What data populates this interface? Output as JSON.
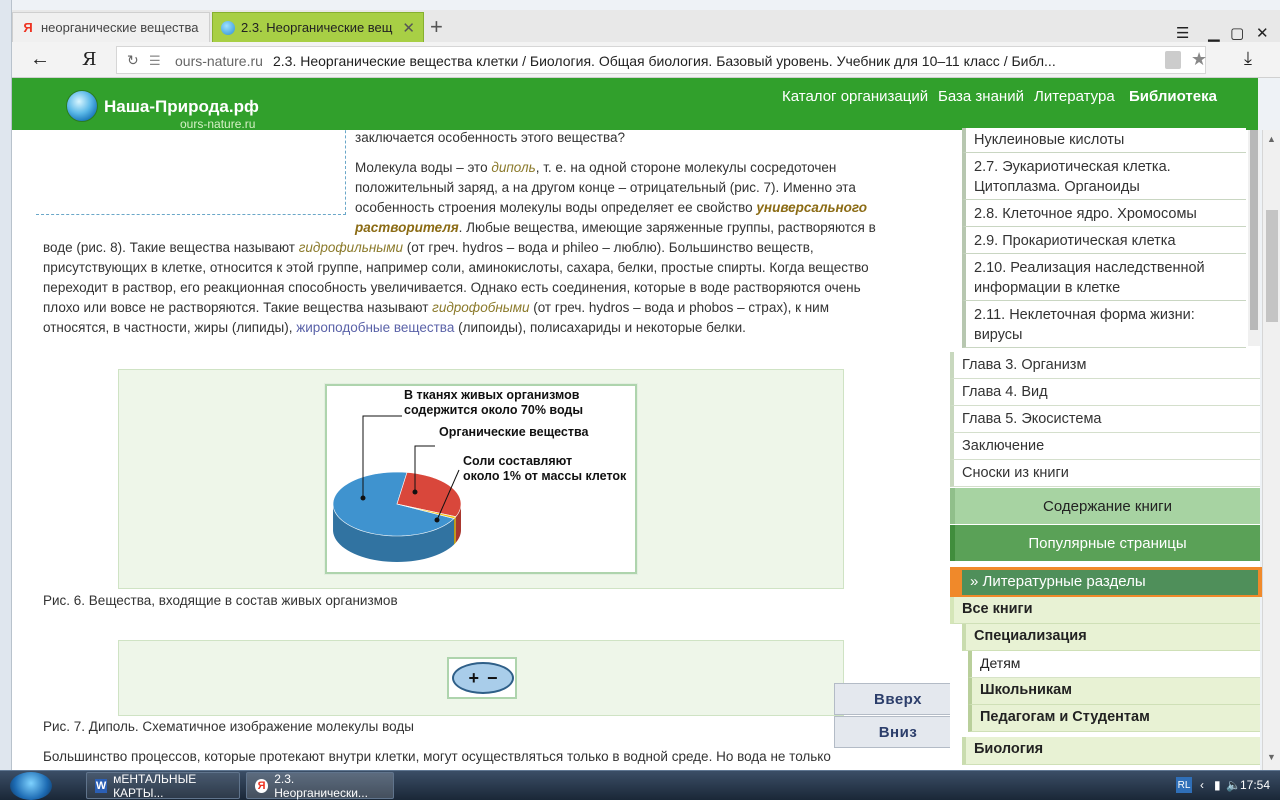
{
  "browser": {
    "tabs": [
      {
        "label": "неорганические вещества к",
        "active": false
      },
      {
        "label": "2.3. Неорганические вещ",
        "active": true
      }
    ],
    "new_tab": "+",
    "address": {
      "ya": "Я",
      "domain": "ours-nature.ru",
      "title": "2.3. Неорганические вещества клетки / Биология. Общая биология. Базовый уровень. Учебник для 10–11 класс / Библ..."
    }
  },
  "site": {
    "logo": "Наша-Природа.рф",
    "logo_sub": "ours-nature.ru",
    "nav": [
      "Каталог организаций",
      "База знаний",
      "Литература",
      "Библиотека"
    ]
  },
  "content": {
    "line_top": "заключается особенность этого вещества?",
    "p1_a": "Молекула воды – это ",
    "p1_term": "диполь",
    "p1_b": ", т. е. на одной стороне молекулы сосредоточен",
    "p1_line2": "положительный заряд, а на другом конце – отрицательный (рис. 7). Именно эта",
    "p1_line3_a": "особенность строения молекулы воды определяет ее свойство ",
    "p1_term2_a": "универсального",
    "p1_term2_b": "растворителя",
    "p1_line4_b": ". Любые вещества, имеющие заряженные группы, растворяются в",
    "p2_line1_a": "воде (рис. 8). Такие вещества называют ",
    "p2_term": "гидрофильными",
    "p2_line1_b": " (от греч. hydros – вода и phileo – люблю). Большинство веществ,",
    "p2_line2": "присутствующих в клетке, относится к этой группе, например соли, аминокислоты, сахара, белки, простые спирты. Когда вещество",
    "p2_line3": "переходит в раствор, его реакционная способность увеличивается. Однако есть соединения, которые в воде растворяются очень",
    "p2_line4_a": "плохо или вовсе не растворяются. Такие вещества называют ",
    "p2_term2": "гидрофобными",
    "p2_line4_b": " (от греч. hydros – вода и phobos – страх), к ним",
    "p2_line5_a": "относятся, в частности, жиры (липиды), ",
    "p2_link": "жироподобные вещества",
    "p2_line5_b": " (липоиды), полисахариды и некоторые белки.",
    "fig6": {
      "label1": "В тканях живых организмов\nсодержится около 70% воды",
      "label2": "Органические вещества",
      "label3": "Соли составляют\nоколо 1% от массы клеток",
      "caption": "Рис. 6. Вещества, входящие в состав живых организмов"
    },
    "fig7": {
      "plus": "+",
      "minus": "−",
      "caption": "Рис. 7. Диполь. Схематичное изображение молекулы воды"
    },
    "bottom_line": "Большинство процессов, которые протекают внутри клетки, могут осуществляться только в водной среде. Но вода не только",
    "btn_up": "Вверх",
    "btn_down": "Вниз"
  },
  "sidebar": {
    "sub_items": [
      "Нуклеиновые кислоты",
      "2.7. Эукариотическая клетка. Цитоплазма. Органоиды",
      "2.8. Клеточное ядро. Хромосомы",
      "2.9. Прокариотическая клетка",
      "2.10. Реализация наследственной информации в клетке",
      "2.11. Неклеточная форма жизни: вирусы"
    ],
    "chapters": [
      "Глава 3. Организм",
      "Глава 4. Вид",
      "Глава 5. Экосистема",
      "Заключение",
      "Сноски из книги"
    ],
    "btn_contents": "Содержание книги",
    "btn_popular": "Популярные страницы",
    "lit_header": "» Литературные разделы",
    "all_books": "Все книги",
    "specialization": "Специализация",
    "children": "Детям",
    "schoolkids": "Школьникам",
    "teachers": "Педагогам и Студентам",
    "biology": "Биология"
  },
  "taskbar": {
    "items": [
      "мЕНТАЛЬНЫЕ КАРТЫ...",
      "2.3. Неорганически..."
    ],
    "lang": "RL",
    "time": "17:54"
  },
  "chart_data": {
    "type": "pie",
    "title": "",
    "categories": [
      "В тканях живых организмов содержится около 70% воды",
      "Органические вещества",
      "Соли составляют около 1% от массы клеток"
    ],
    "values": [
      70,
      29,
      1
    ],
    "colors": [
      "#3f93cf",
      "#d9473b",
      "#f1c40f"
    ]
  }
}
